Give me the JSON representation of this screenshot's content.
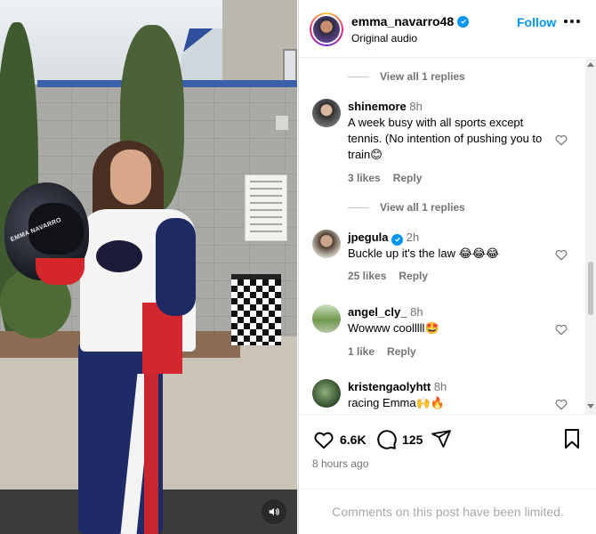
{
  "post": {
    "username": "emma_navarro48",
    "audio": "Original audio",
    "follow_label": "Follow",
    "helmet_text": "EMMA NAVARRO"
  },
  "comments": [
    {
      "type": "replies",
      "label": "View all 1 replies"
    },
    {
      "user": "shinemore",
      "time": "8h",
      "text": "A week busy with all sports except tennis.  (No intention of pushing you to train😊",
      "likes": "3 likes",
      "reply": "Reply"
    },
    {
      "type": "replies",
      "label": "View all 1 replies"
    },
    {
      "user": "jpegula",
      "verified": true,
      "time": "2h",
      "text": "Buckle up it's the law 😂😂😂",
      "likes": "25 likes",
      "reply": "Reply"
    },
    {
      "user": "angel_cly_",
      "time": "8h",
      "text": "Wowww coolllll🤩",
      "likes": "1 like",
      "reply": "Reply"
    },
    {
      "user": "kristengaolyhtt",
      "time": "8h",
      "text": "racing Emma🙌🔥"
    }
  ],
  "actions": {
    "likes": "6.6K",
    "comments": "125",
    "time_ago": "8 hours ago",
    "limited_notice": "Comments on this post have been limited."
  },
  "colors": {
    "accent": "#0095f6",
    "muted": "#737373",
    "border": "#dbdbdb"
  },
  "icons": [
    "sound-icon",
    "verified-icon",
    "more-icon",
    "heart-icon",
    "comment-icon",
    "share-icon",
    "bookmark-icon"
  ]
}
